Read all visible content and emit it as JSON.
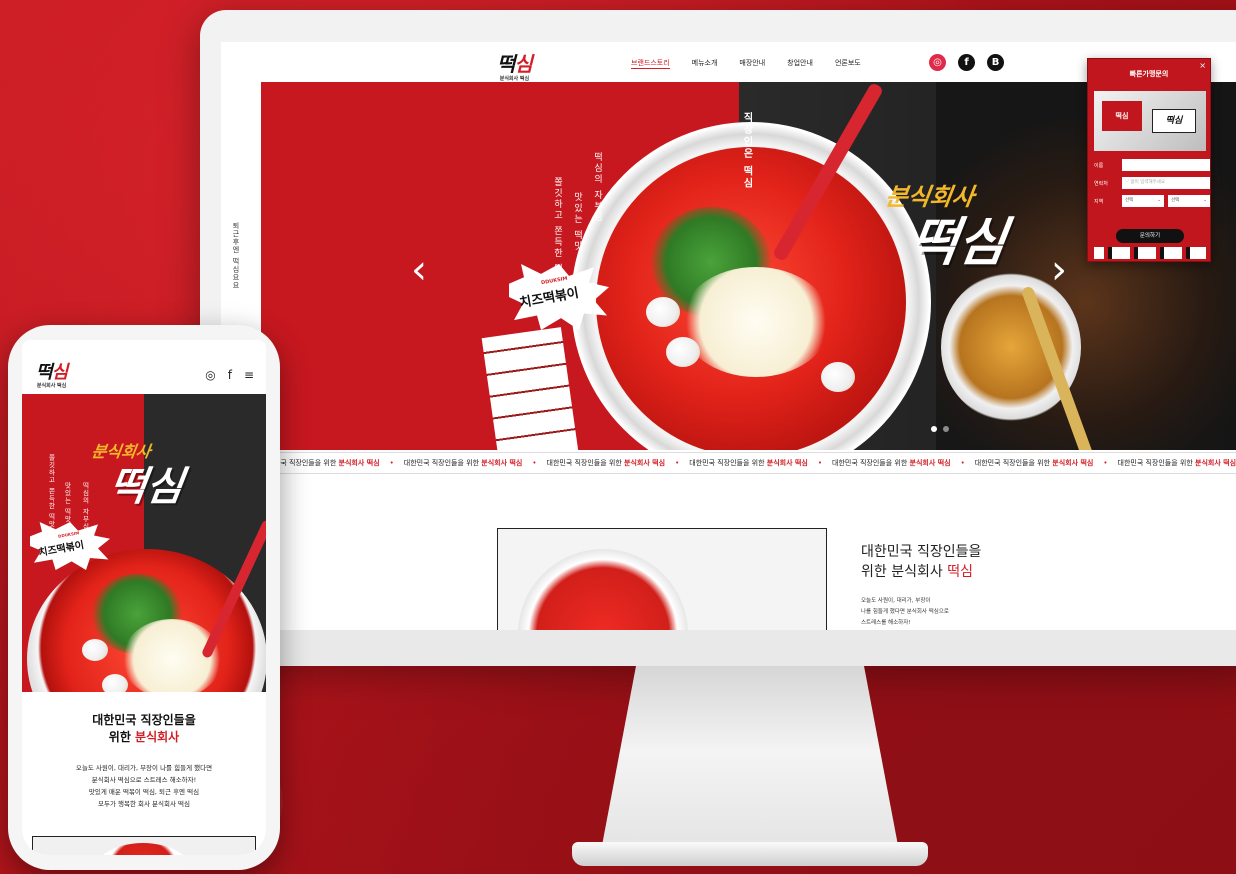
{
  "desktop": {
    "logo": {
      "text_a": "떡",
      "text_b": "심",
      "tagline": "분식회사 떡심"
    },
    "nav": [
      {
        "label": "브랜드스토리",
        "active": true
      },
      {
        "label": "메뉴소개",
        "active": false
      },
      {
        "label": "매장안내",
        "active": false
      },
      {
        "label": "창업안내",
        "active": false
      },
      {
        "label": "언론보도",
        "active": false
      }
    ],
    "social": {
      "instagram": "◎",
      "facebook": "f",
      "blog": "B"
    },
    "side_vertical": "퇴근후엔 떡심요요",
    "hero": {
      "brand_sub": "분식회사",
      "brand_main": "떡심",
      "vertical_1": "떡심의 자부심",
      "vertical_2": "쫄깃하고 쫀득한 떡맛",
      "vertical_3": "맛있는 떡맛",
      "vertical_4": "직장인은 떡심",
      "burst_small": "DDUKSIM",
      "burst_text": "치즈떡볶이",
      "arrow_left": "‹",
      "arrow_right": "›",
      "slide_current": 1,
      "slide_total": 2
    },
    "ticker": {
      "prefix": "대한민국 직장인들을 위한",
      "brand": "분식회사 떡심",
      "separator": "•"
    },
    "intro": {
      "title_line1": "대한민국 직장인들을",
      "title_line2_prefix": "위한 분식회사 ",
      "title_line2_brand": "떡심",
      "desc_line1": "오늘도 사원이, 대리가, 부장이",
      "desc_line2": "나를 힘들게 했다면 분식회사 떡심으로",
      "desc_line3": "스트레스를 해소하자!"
    },
    "popup": {
      "title": "빠른가맹문의",
      "close": "×",
      "sign_text": "떡심",
      "sign_red": "떡심",
      "fields": {
        "name_label": "이름",
        "phone_label": "연락처",
        "phone_placeholder": "'-' 없이 입력해주세요",
        "region_label": "지역",
        "select_1": "선택",
        "select_2": "선택"
      },
      "button": "문의하기"
    }
  },
  "mobile": {
    "logo": {
      "text_a": "떡",
      "text_b": "심",
      "tagline": "분식회사 떡심"
    },
    "icons": {
      "instagram": "◎",
      "facebook": "f",
      "menu": "≡"
    },
    "hero": {
      "brand_sub": "분식회사",
      "brand_main": "떡심",
      "vertical_1": "쫄깃하고 쫀득한 떡맛",
      "vertical_2": "맛있는 떡맛",
      "vertical_3": "떡심의 자부심",
      "burst_small": "DDUKSIM",
      "burst_text": "치즈떡볶이"
    },
    "intro": {
      "title_line1": "대한민국 직장인들을",
      "title_line2_prefix": "위한 ",
      "title_line2_brand": "분식회사",
      "desc": [
        "오늘도 사원이, 대리가, 부장이 나를 힘들게 했다면",
        "분식회사 떡심으로 스트레스 해소하자!",
        "맛있게 매운 떡볶이 떡심, 퇴근 후엔 떡심",
        "모두가 행복한 회사 분식회사 떡심"
      ]
    }
  },
  "colors": {
    "background": "#b5141c",
    "brand_red": "#d21f26",
    "accent_yellow": "#f3b82a",
    "dark": "#1a1a1a"
  }
}
